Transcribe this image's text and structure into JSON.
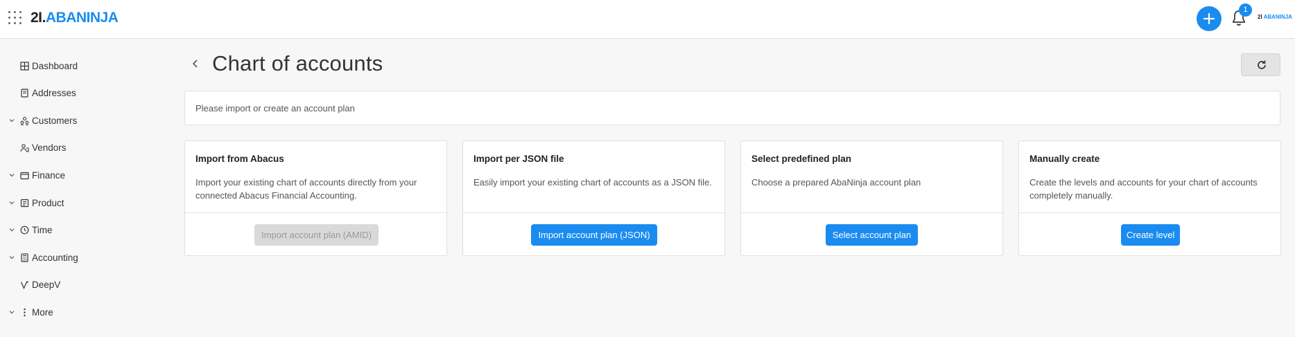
{
  "header": {
    "logo_number": "2I.",
    "logo_name": "ABANINJA",
    "notification_count": "1",
    "mini_logo_number": "2I",
    "mini_logo_name": "ABANINJA",
    "apps_icon": "grid-dots-icon",
    "add_icon": "plus-icon",
    "bell_icon": "bell-icon"
  },
  "sidebar": {
    "items": [
      {
        "label": "Dashboard",
        "icon": "dashboard-icon",
        "expandable": false
      },
      {
        "label": "Addresses",
        "icon": "address-book-icon",
        "expandable": false
      },
      {
        "label": "Customers",
        "icon": "customers-icon",
        "expandable": true
      },
      {
        "label": "Vendors",
        "icon": "vendors-icon",
        "expandable": false
      },
      {
        "label": "Finance",
        "icon": "wallet-icon",
        "expandable": true
      },
      {
        "label": "Product",
        "icon": "product-icon",
        "expandable": true
      },
      {
        "label": "Time",
        "icon": "clock-icon",
        "expandable": true
      },
      {
        "label": "Accounting",
        "icon": "calculator-icon",
        "expandable": true
      },
      {
        "label": "DeepV",
        "icon": "deepv-icon",
        "expandable": false
      },
      {
        "label": "More",
        "icon": "more-vertical-icon",
        "expandable": true
      }
    ]
  },
  "main": {
    "title": "Chart of accounts",
    "info_text": "Please import or create an account plan",
    "cards": [
      {
        "title": "Import from Abacus",
        "description": "Import your existing chart of accounts directly from your connected Abacus Financial Accounting.",
        "button": "Import account plan (AMID)",
        "button_disabled": true
      },
      {
        "title": "Import per JSON file",
        "description": "Easily import your existing chart of accounts as a JSON file.",
        "button": "Import account plan (JSON)",
        "button_disabled": false
      },
      {
        "title": "Select predefined plan",
        "description": "Choose a prepared AbaNinja account plan",
        "button": "Select account plan",
        "button_disabled": false
      },
      {
        "title": "Manually create",
        "description": "Create the levels and accounts for your chart of accounts completely manually.",
        "button": "Create level",
        "button_disabled": false
      }
    ]
  },
  "colors": {
    "accent": "#1a8cf0",
    "background": "#f7f7f7",
    "disabled_button": "#d9d9d9"
  }
}
